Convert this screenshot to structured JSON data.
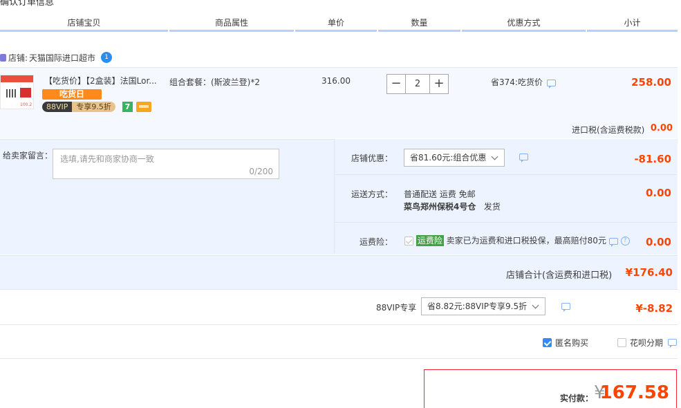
{
  "top_cutoff_text": "确认订单信息",
  "columns": [
    "店铺宝贝",
    "商品属性",
    "单价",
    "数量",
    "优惠方式",
    "小计"
  ],
  "shop": {
    "label": "店铺:",
    "name": "天猫国际进口超市"
  },
  "item": {
    "title": "【吃货价】【2盒装】法国Lor...",
    "tag_promo": "吃货日",
    "tag_vip_a": "88VIP",
    "tag_vip_b": "专享9.5折",
    "tag_7": "7",
    "attr": "组合套餐：(斯波兰登)*2",
    "unit_price": "316.00",
    "qty_minus": "−",
    "qty": "2",
    "qty_plus": "+",
    "promo": "省374:吃货价",
    "subtotal": "258.00",
    "thumb_label": "100.2"
  },
  "tax": {
    "label": "进口税(含运费税款)",
    "value": "0.00"
  },
  "message": {
    "label": "给卖家留言：",
    "placeholder": "选填,请先和商家协商一致",
    "count": "0/200"
  },
  "shop_discount": {
    "label": "店铺优惠：",
    "selected": "省81.60元:组合优惠",
    "value": "-81.60"
  },
  "shipping": {
    "label": "运送方式：",
    "line1": "普通配送 运费 免邮",
    "warehouse": "菜鸟郑州保税4号仓",
    "ship_from": "发货",
    "value": "0.00"
  },
  "insurance": {
    "label": "运费险：",
    "tag": "运费险",
    "text": "卖家已为运费和进口税投保，最高赔付80元",
    "help": "?",
    "value": "0.00"
  },
  "shop_total": {
    "label": "店铺合计(含运费和进口税)",
    "value": "¥176.40"
  },
  "vip": {
    "label": "88VIP专享",
    "selected": "省8.82元:88VIP专享9.5折",
    "value": "¥-8.82"
  },
  "anonymous": {
    "label": "匿名购买",
    "checked": true
  },
  "huabei": {
    "label": "花呗分期",
    "checked": false
  },
  "pay": {
    "label": "实付款：",
    "currency": "¥",
    "value": "167.58"
  },
  "colors": {
    "accent_price": "#ff4400",
    "header_border": "#b2d1ff",
    "panel_bg": "#eef4ff",
    "pay_border": "#ff2233"
  },
  "icons": [
    "shop-icon",
    "wangwang-icon",
    "chat-icon",
    "help-icon",
    "chevron-down-icon",
    "checkbox-icon"
  ]
}
